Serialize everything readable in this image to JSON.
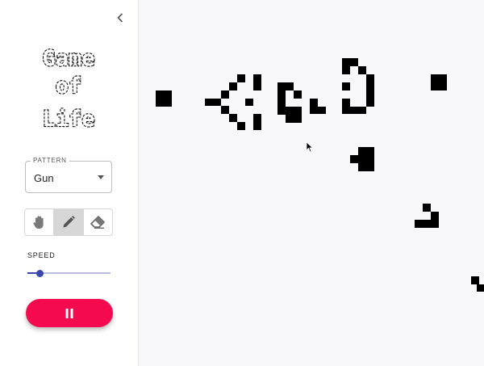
{
  "app": {
    "title_lines": [
      "Game",
      "of",
      "Life"
    ]
  },
  "sidebar": {
    "collapse_icon": "chevron-left-icon",
    "pattern": {
      "label": "PATTERN",
      "value": "Gun"
    },
    "tools": [
      {
        "name": "pan",
        "icon": "hand-icon",
        "active": false
      },
      {
        "name": "draw",
        "icon": "pencil-icon",
        "active": true
      },
      {
        "name": "erase",
        "icon": "eraser-icon",
        "active": false
      }
    ],
    "speed": {
      "label": "SPEED",
      "value_fraction": 0.15
    },
    "play_button": {
      "icon": "pause-icon",
      "state": "running"
    }
  },
  "colors": {
    "accent": "#f50a4f",
    "slider": "#3949ab",
    "cell": "#000000",
    "board_background": "#f8f7fa"
  }
}
